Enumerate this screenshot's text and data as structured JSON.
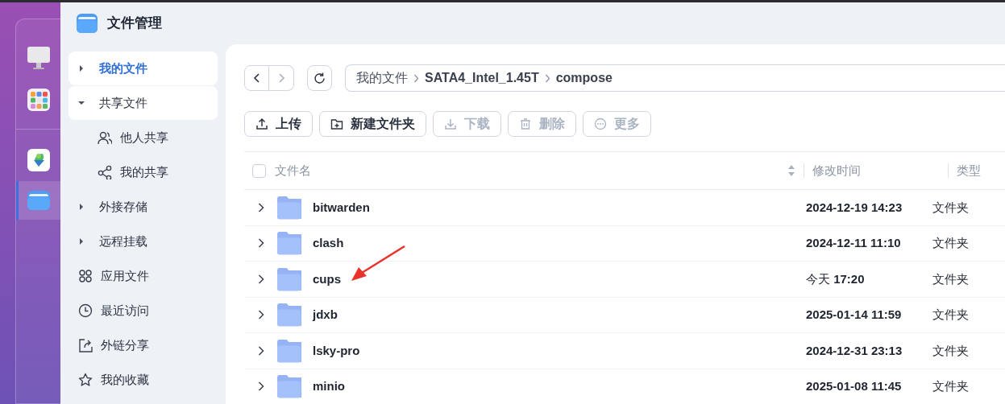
{
  "app": {
    "title": "文件管理"
  },
  "dock": [
    {
      "kind": "monitor",
      "selected": false
    },
    {
      "kind": "apps",
      "selected": false
    },
    {
      "kind": "app",
      "selected": false
    },
    {
      "kind": "folder",
      "selected": true
    }
  ],
  "sidebar": {
    "items": [
      {
        "kind": "expander",
        "label": "我的文件",
        "expanded": false,
        "selected": true,
        "hovered": false
      },
      {
        "kind": "expander",
        "label": "共享文件",
        "expanded": true,
        "selected": false,
        "hovered": true,
        "children": [
          {
            "kind": "people",
            "label": "他人共享",
            "selected": false,
            "hovered": false
          },
          {
            "kind": "share",
            "label": "我的共享",
            "selected": false,
            "hovered": false
          }
        ]
      },
      {
        "kind": "expander",
        "label": "外接存储",
        "expanded": false,
        "selected": false,
        "hovered": false
      },
      {
        "kind": "expander",
        "label": "远程挂载",
        "expanded": false,
        "selected": false,
        "hovered": false
      },
      {
        "kind": "apps",
        "label": "应用文件",
        "selected": false,
        "hovered": false
      },
      {
        "kind": "clock",
        "label": "最近访问",
        "selected": false,
        "hovered": false
      },
      {
        "kind": "link",
        "label": "外链分享",
        "selected": false,
        "hovered": false
      },
      {
        "kind": "star",
        "label": "我的收藏",
        "selected": false,
        "hovered": false
      }
    ]
  },
  "nav": {
    "back": {
      "disabled": false
    },
    "forward": {
      "disabled": true
    }
  },
  "breadcrumb": [
    "我的文件",
    "SATA4_Intel_1.45T",
    "compose"
  ],
  "toolbar": [
    {
      "kind": "upload",
      "label": "上传",
      "disabled": false
    },
    {
      "kind": "new-folder",
      "label": "新建文件夹",
      "disabled": false
    },
    {
      "kind": "download",
      "label": "下载",
      "disabled": true
    },
    {
      "kind": "delete",
      "label": "删除",
      "disabled": true
    },
    {
      "kind": "more",
      "label": "更多",
      "disabled": true
    }
  ],
  "table": {
    "select_all": {
      "checked": false
    },
    "columns": [
      "文件名",
      "修改时间",
      "类型"
    ],
    "rows": [
      {
        "name": "bitwarden",
        "modified": "2024-12-19 14:23",
        "type": "文件夹",
        "arrow_annotation": false
      },
      {
        "name": "clash",
        "modified": "2024-12-11 11:10",
        "type": "文件夹",
        "arrow_annotation": false
      },
      {
        "name": "cups",
        "modified": "今天 **17:20**",
        "type": "文件夹",
        "arrow_annotation": true
      },
      {
        "name": "jdxb",
        "modified": "2025-01-14 11:59",
        "type": "文件夹",
        "arrow_annotation": false
      },
      {
        "name": "lsky-pro",
        "modified": "2024-12-31 23:13",
        "type": "文件夹",
        "arrow_annotation": false
      },
      {
        "name": "minio",
        "modified": "2025-01-08 11:45",
        "type": "文件夹",
        "arrow_annotation": false
      }
    ]
  }
}
